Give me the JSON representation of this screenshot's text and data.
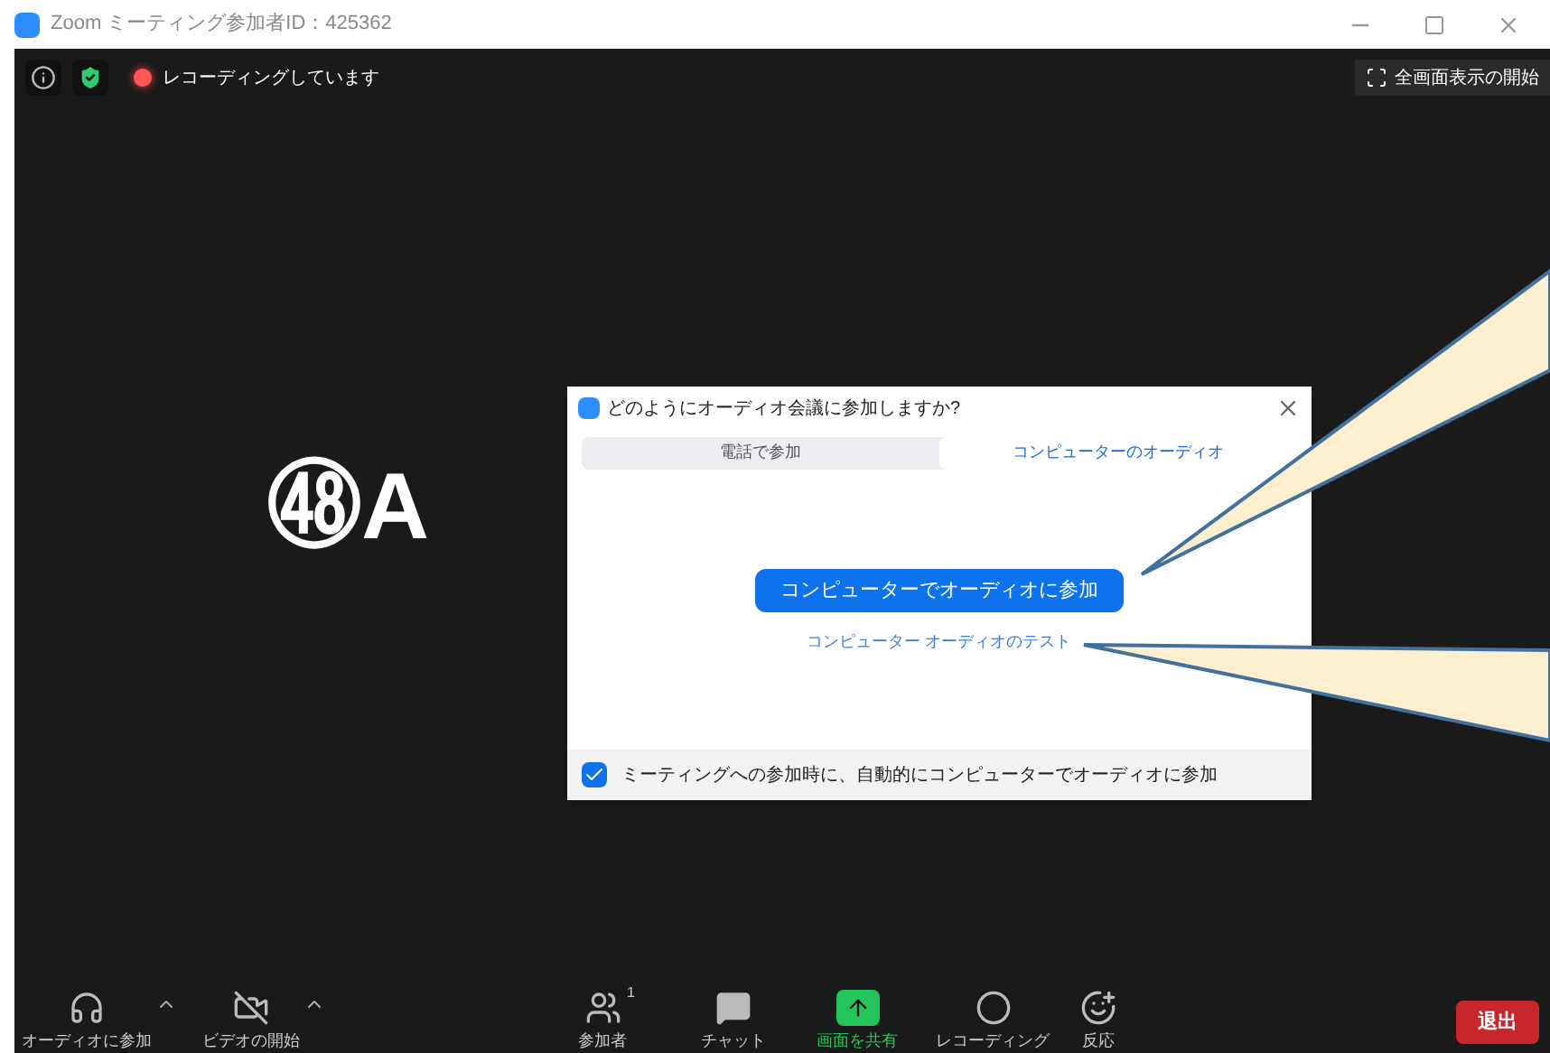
{
  "window": {
    "title": "Zoom ミーティング参加者ID：425362"
  },
  "top_bar": {
    "recording_label": "レコーディングしています",
    "fullscreen_button": "全画面表示の開始"
  },
  "participant": {
    "name": "㊽A"
  },
  "dialog": {
    "title": "どのようにオーディオ会議に参加しますか?",
    "tabs": [
      {
        "label": "電話で参加",
        "selected": false
      },
      {
        "label": "コンピューターのオーディオ",
        "selected": true
      }
    ],
    "join_button": "コンピューターでオーディオに参加",
    "test_link": "コンピューター オーディオのテスト",
    "auto_join": {
      "label": "ミーティングへの参加時に、自動的にコンピューターでオーディオに参加",
      "checked": true
    }
  },
  "toolbar": {
    "items": [
      {
        "kind": "audio",
        "label": "オーディオに参加",
        "caret": true,
        "color": "#cccccc"
      },
      {
        "kind": "video",
        "label": "ビデオの開始",
        "caret": true,
        "color": "#cccccc"
      },
      {
        "kind": "participants",
        "label": "参加者",
        "count": "1",
        "caret": false,
        "color": "#cccccc"
      },
      {
        "kind": "chat",
        "label": "チャット",
        "caret": false,
        "color": "#cccccc"
      },
      {
        "kind": "share",
        "label": "画面を共有",
        "caret": false,
        "color": "#23c45a"
      },
      {
        "kind": "record",
        "label": "レコーディング",
        "caret": false,
        "color": "#cccccc"
      },
      {
        "kind": "reaction",
        "label": "反応",
        "caret": false,
        "color": "#cccccc"
      }
    ],
    "leave_button": "退出"
  }
}
